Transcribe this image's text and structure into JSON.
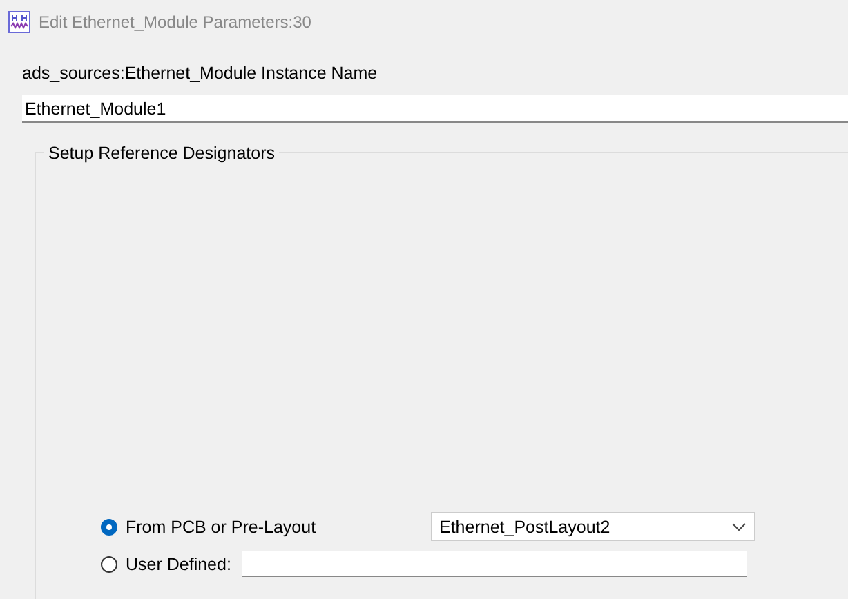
{
  "window": {
    "title": "Edit Ethernet_Module Parameters:30"
  },
  "instance_name": {
    "label": "ads_sources:Ethernet_Module Instance Name",
    "value": "Ethernet_Module1"
  },
  "group": {
    "title": "Setup Reference Designators",
    "options": [
      {
        "label": "From PCB or Pre-Layout",
        "selected": true,
        "kind": "dropdown",
        "value": "Ethernet_PostLayout2"
      },
      {
        "label": "User Defined:",
        "selected": false,
        "kind": "text"
      }
    ]
  }
}
